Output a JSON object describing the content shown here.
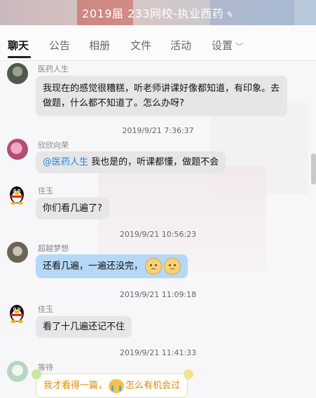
{
  "window": {
    "title": "2019届 233网校-执业西药"
  },
  "tabs": [
    {
      "label": "聊天",
      "active": true
    },
    {
      "label": "公告"
    },
    {
      "label": "相册"
    },
    {
      "label": "文件"
    },
    {
      "label": "活动"
    },
    {
      "label": "设置"
    }
  ],
  "messages": [
    {
      "sender": "医药人生",
      "line1": "我现在的感觉很糟糕，听老师讲课好像都知道，有印象。去",
      "line2": "做题，什么都不知道了。怎么办呀?"
    },
    {
      "timestamp": "2019/9/21 7:36:37"
    },
    {
      "sender": "欣欣向荣",
      "mention": "@医药人生",
      "text": " 我也是的，听课都懂，做题不会"
    },
    {
      "sender": "佳玉",
      "text": "你们看几遍了?"
    },
    {
      "timestamp": "2019/9/21 10:56:23"
    },
    {
      "sender": "超越梦想",
      "text": "还看几遍，一遍还没完，",
      "emoji": [
        "worried-face",
        "worried-face"
      ]
    },
    {
      "timestamp": "2019/9/21 11:09:18"
    },
    {
      "sender": "佳玉",
      "text": "看了十几遍还记不住"
    },
    {
      "timestamp": "2019/9/21 11:41:33"
    },
    {
      "sender": "等待",
      "text_a": "我才看得一篇，",
      "text_b": "怎么有机会过",
      "emoji": [
        "crying-face"
      ]
    }
  ],
  "colors": {
    "bubble_gray": "#e6e6e8",
    "bubble_blue": "#b6d8f6",
    "mention": "#2b86d9",
    "fancy_text": "#e08a00"
  }
}
